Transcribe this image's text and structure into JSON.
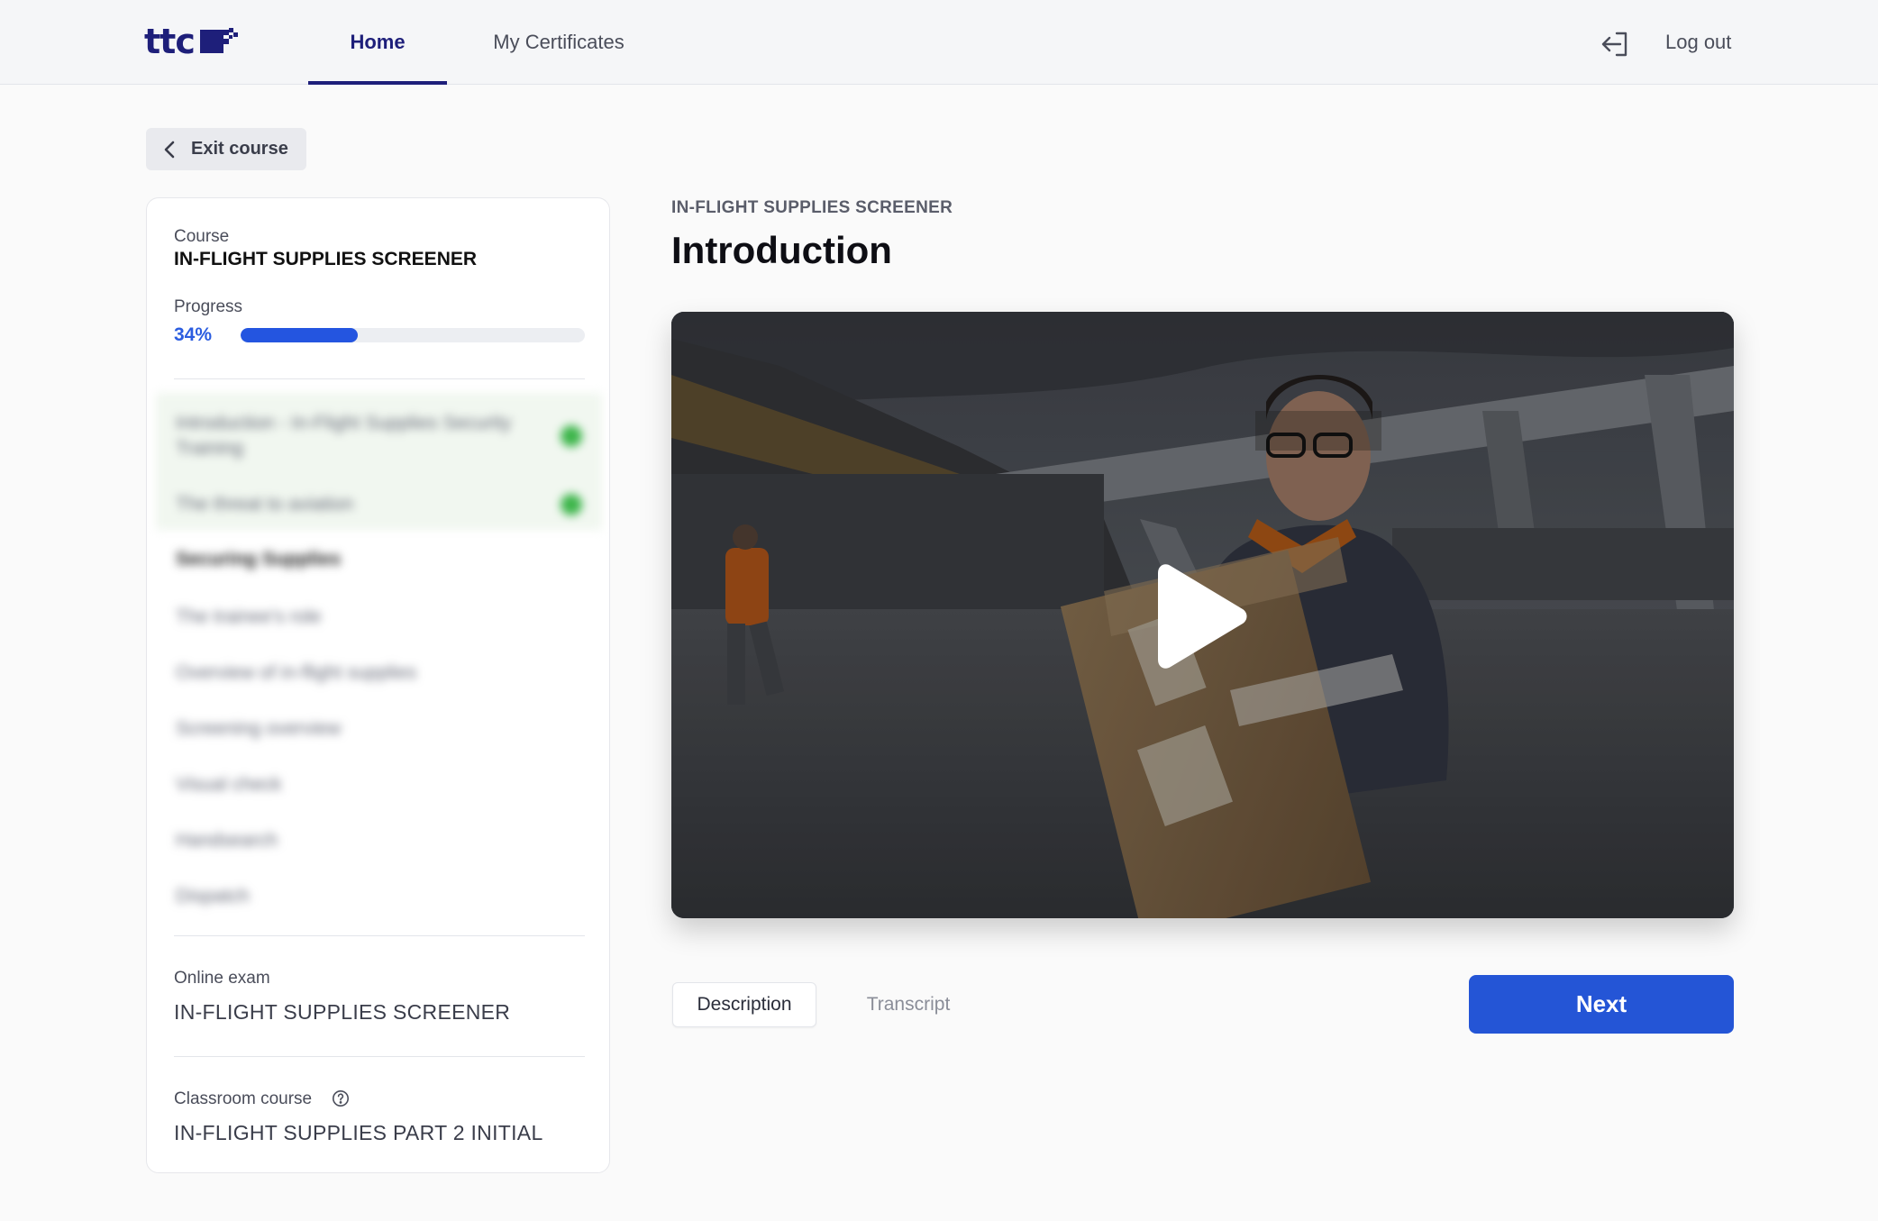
{
  "header": {
    "logo_text": "ttc",
    "nav": [
      {
        "label": "Home",
        "active": true
      },
      {
        "label": "My Certificates",
        "active": false
      }
    ],
    "logout_label": "Log out",
    "brand_color": "#1e1f7a"
  },
  "exit_label": "Exit course",
  "sidebar": {
    "course_label": "Course",
    "course_title": "IN-FLIGHT SUPPLIES SCREENER",
    "progress_label": "Progress",
    "progress_text": "34%",
    "progress_value": 0.34,
    "lessons": [
      {
        "label": "Introduction - In-Flight Supplies Security Training",
        "status": "done"
      },
      {
        "label": "The threat to aviation",
        "status": "done"
      },
      {
        "label": "Securing Supplies",
        "status": "section"
      },
      {
        "label": "The trainee's role",
        "status": "todo"
      },
      {
        "label": "Overview of in-flight supplies",
        "status": "todo"
      },
      {
        "label": "Screening overview",
        "status": "todo"
      },
      {
        "label": "Visual check",
        "status": "todo"
      },
      {
        "label": "Handsearch",
        "status": "todo"
      },
      {
        "label": "Dispatch",
        "status": "todo"
      }
    ],
    "online_exam_label": "Online exam",
    "online_exam_value": "IN-FLIGHT SUPPLIES SCREENER",
    "classroom_label": "Classroom course",
    "classroom_value": "IN-FLIGHT SUPPLIES PART 2 INITIAL"
  },
  "main": {
    "eyebrow": "IN-FLIGHT SUPPLIES SCREENER",
    "title": "Introduction",
    "tabs": {
      "description": "Description",
      "transcript": "Transcript"
    },
    "next_label": "Next",
    "accent_color": "#2455d6"
  }
}
